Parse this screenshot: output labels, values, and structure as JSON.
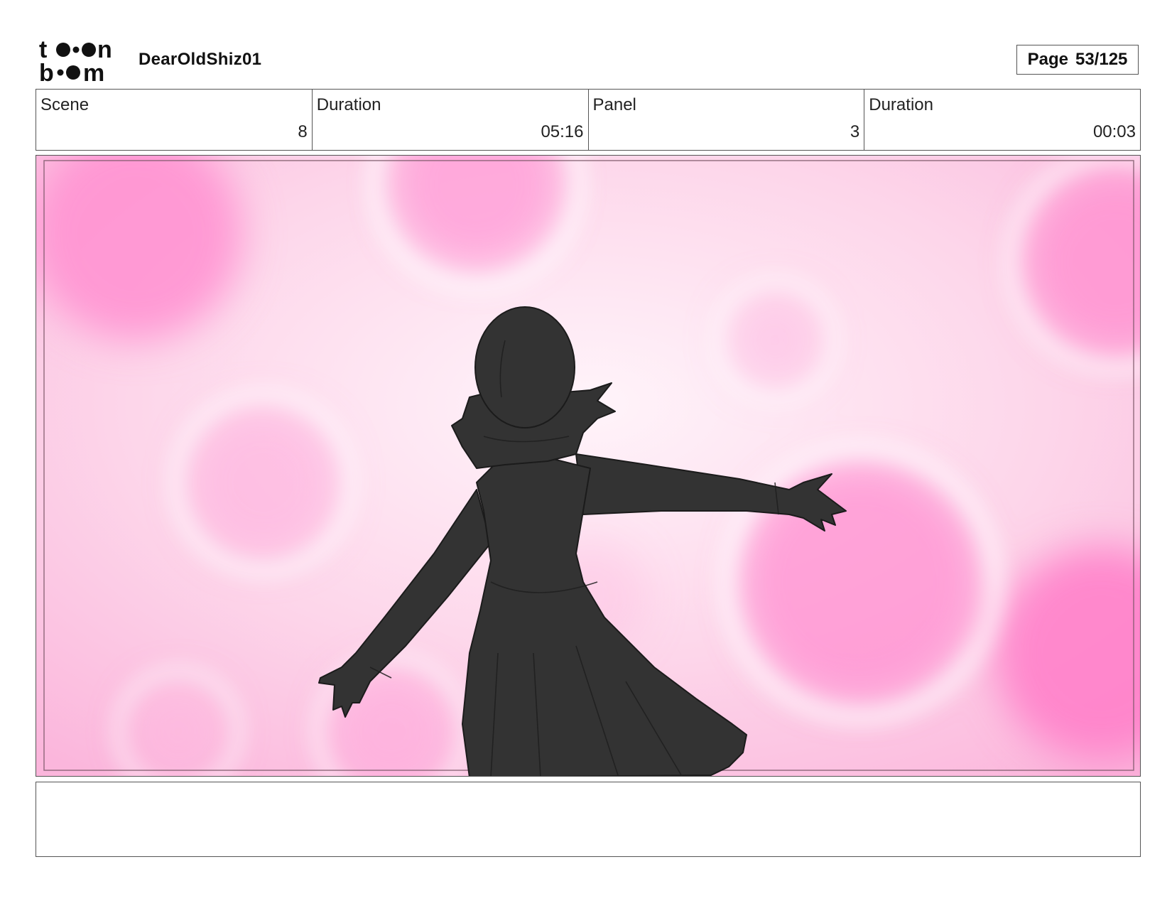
{
  "header": {
    "logo_top": "to•n",
    "logo_bottom": "b••m",
    "project_title": "DearOldShiz01",
    "page_label": "Page",
    "page_number": "53/125"
  },
  "info": [
    {
      "label": "Scene",
      "value": "8"
    },
    {
      "label": "Duration",
      "value": "05:16"
    },
    {
      "label": "Panel",
      "value": "3"
    },
    {
      "label": "Duration",
      "value": "00:03"
    }
  ],
  "panel": {
    "background_color": "#fde6f2",
    "bokeh_color": "#ff8fd0",
    "silhouette_color": "#333333"
  },
  "notes": {
    "text": ""
  }
}
